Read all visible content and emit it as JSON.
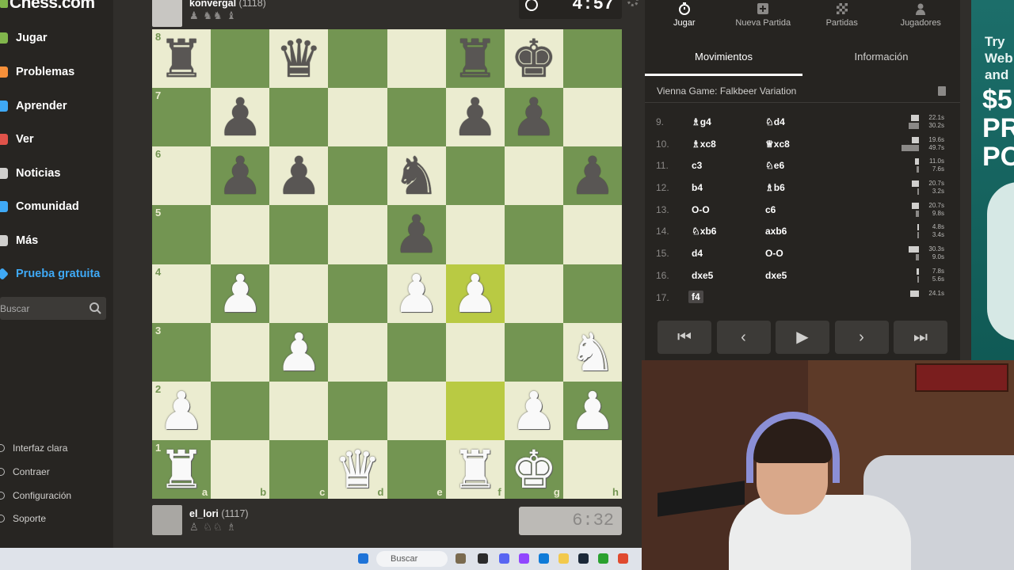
{
  "brand": {
    "logo_text": "Chess.com"
  },
  "sidebar": {
    "items": [
      {
        "label": "Jugar",
        "color": "#81b64c"
      },
      {
        "label": "Problemas",
        "color": "#f7903a"
      },
      {
        "label": "Aprender",
        "color": "#3fa9f5"
      },
      {
        "label": "Ver",
        "color": "#e0534a"
      },
      {
        "label": "Noticias",
        "color": "#d0cfcd"
      },
      {
        "label": "Comunidad",
        "color": "#3fa9f5"
      },
      {
        "label": "Más",
        "color": "#d0cfcd"
      }
    ],
    "trial": {
      "label": "Prueba gratuita"
    },
    "search_placeholder": "Buscar",
    "footer": [
      {
        "label": "Interfaz clara"
      },
      {
        "label": "Contraer"
      },
      {
        "label": "Configuración"
      },
      {
        "label": "Soporte"
      }
    ]
  },
  "top_player": {
    "name": "konvergal",
    "rating": "(1118)",
    "clock": "4:57",
    "captured": "♟ ♞♞ ♝"
  },
  "bottom_player": {
    "name": "el_lori",
    "rating": "(1117)",
    "clock": "6:32",
    "captured": "♙ ♘♘ ♗"
  },
  "board": {
    "ranks": [
      "8",
      "7",
      "6",
      "5",
      "4",
      "3",
      "2",
      "1"
    ],
    "files": [
      "a",
      "b",
      "c",
      "d",
      "e",
      "f",
      "g",
      "h"
    ],
    "position": [
      [
        "br",
        "",
        "bq",
        "",
        "",
        "br",
        "bk",
        ""
      ],
      [
        "",
        "bp",
        "",
        "",
        "",
        "bp",
        "bp",
        ""
      ],
      [
        "",
        "bp",
        "bp",
        "",
        "bn",
        "",
        "",
        "bp"
      ],
      [
        "",
        "",
        "",
        "",
        "bp",
        "",
        "",
        ""
      ],
      [
        "",
        "wp",
        "",
        "",
        "wp",
        "wp",
        "",
        ""
      ],
      [
        "",
        "",
        "wp",
        "",
        "",
        "",
        "",
        "wn"
      ],
      [
        "wp",
        "",
        "",
        "",
        "",
        "",
        "wp",
        "wp"
      ],
      [
        "wr",
        "",
        "",
        "wq",
        "",
        "wr",
        "wk",
        ""
      ]
    ],
    "last_move": [
      "f2",
      "f4"
    ],
    "colors": {
      "light": "#ebecd0",
      "dark": "#739552"
    }
  },
  "panel": {
    "tabs": [
      {
        "label": "Jugar",
        "icon": "stopwatch-icon"
      },
      {
        "label": "Nueva Partida",
        "icon": "plus-icon"
      },
      {
        "label": "Partidas",
        "icon": "board-icon"
      },
      {
        "label": "Jugadores",
        "icon": "players-icon"
      }
    ],
    "subtabs": [
      "Movimientos",
      "Información"
    ],
    "opening": "Vienna Game: Falkbeer Variation",
    "moves": [
      {
        "num": "9.",
        "white": "g4",
        "white_piece": "♗",
        "black": "d4",
        "black_piece": "♘",
        "wt": "22.1s",
        "bt": "30.2s"
      },
      {
        "num": "10.",
        "white": "xc8",
        "white_piece": "♗",
        "black": "xc8",
        "black_piece": "♕",
        "wt": "19.6s",
        "bt": "49.7s"
      },
      {
        "num": "11.",
        "white": "c3",
        "white_piece": "",
        "black": "e6",
        "black_piece": "♘",
        "wt": "11.0s",
        "bt": "7.6s"
      },
      {
        "num": "12.",
        "white": "b4",
        "white_piece": "",
        "black": "b6",
        "black_piece": "♗",
        "wt": "20.7s",
        "bt": "3.2s"
      },
      {
        "num": "13.",
        "white": "O-O",
        "white_piece": "",
        "black": "c6",
        "black_piece": "",
        "wt": "20.7s",
        "bt": "9.8s"
      },
      {
        "num": "14.",
        "white": "xb6",
        "white_piece": "♘",
        "black": "axb6",
        "black_piece": "",
        "wt": "4.8s",
        "bt": "3.4s"
      },
      {
        "num": "15.",
        "white": "d4",
        "white_piece": "",
        "black": "O-O",
        "black_piece": "",
        "wt": "30.3s",
        "bt": "9.0s"
      },
      {
        "num": "16.",
        "white": "dxe5",
        "white_piece": "",
        "black": "dxe5",
        "black_piece": "",
        "wt": "7.8s",
        "bt": "5.6s"
      },
      {
        "num": "17.",
        "white": "f4",
        "white_piece": "",
        "black": "",
        "black_piece": "",
        "wt": "24.1s",
        "bt": ""
      }
    ],
    "controls": [
      "⏮",
      "‹",
      "▶",
      "›",
      "⏭"
    ]
  },
  "ad": {
    "line1": "Try Web and",
    "line2": "$5 PR PO"
  },
  "taskbar": {
    "search_label": "Buscar"
  }
}
